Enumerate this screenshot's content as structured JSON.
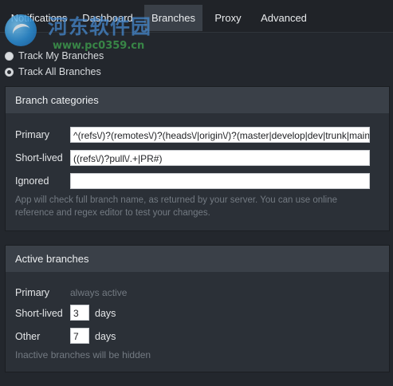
{
  "tabs": [
    {
      "label": "Notifications",
      "active": false
    },
    {
      "label": "Dashboard",
      "active": false
    },
    {
      "label": "Branches",
      "active": true
    },
    {
      "label": "Proxy",
      "active": false
    },
    {
      "label": "Advanced",
      "active": false
    }
  ],
  "watermark": {
    "text_cn": "河东软件园",
    "url": "www.pc0359.cn"
  },
  "tracking": {
    "options": [
      {
        "label": "Track My Branches",
        "checked": false
      },
      {
        "label": "Track All Branches",
        "checked": true
      }
    ]
  },
  "branch_categories": {
    "title": "Branch categories",
    "primary_label": "Primary",
    "primary_value": "^(refs\\/)?(remotes\\/)?(heads\\/|origin\\/)?(master|develop|dev|trunk|main|r",
    "short_lived_label": "Short-lived",
    "short_lived_value": "((refs\\/)?pull\\/.+|PR#)",
    "ignored_label": "Ignored",
    "ignored_value": "",
    "help": "App will check full branch name, as returned by your server. You can use online reference and regex editor to test your changes."
  },
  "active_branches": {
    "title": "Active branches",
    "primary_label": "Primary",
    "primary_status": "always active",
    "short_lived_label": "Short-lived",
    "short_lived_days": "3",
    "other_label": "Other",
    "other_days": "7",
    "days_unit": "days",
    "note": "Inactive branches will be hidden"
  },
  "colors": {
    "background": "#23272d",
    "panel": "#2b3037",
    "panel_header": "#3a4048",
    "active_tab": "#3a4048",
    "muted_text": "#737a82"
  }
}
